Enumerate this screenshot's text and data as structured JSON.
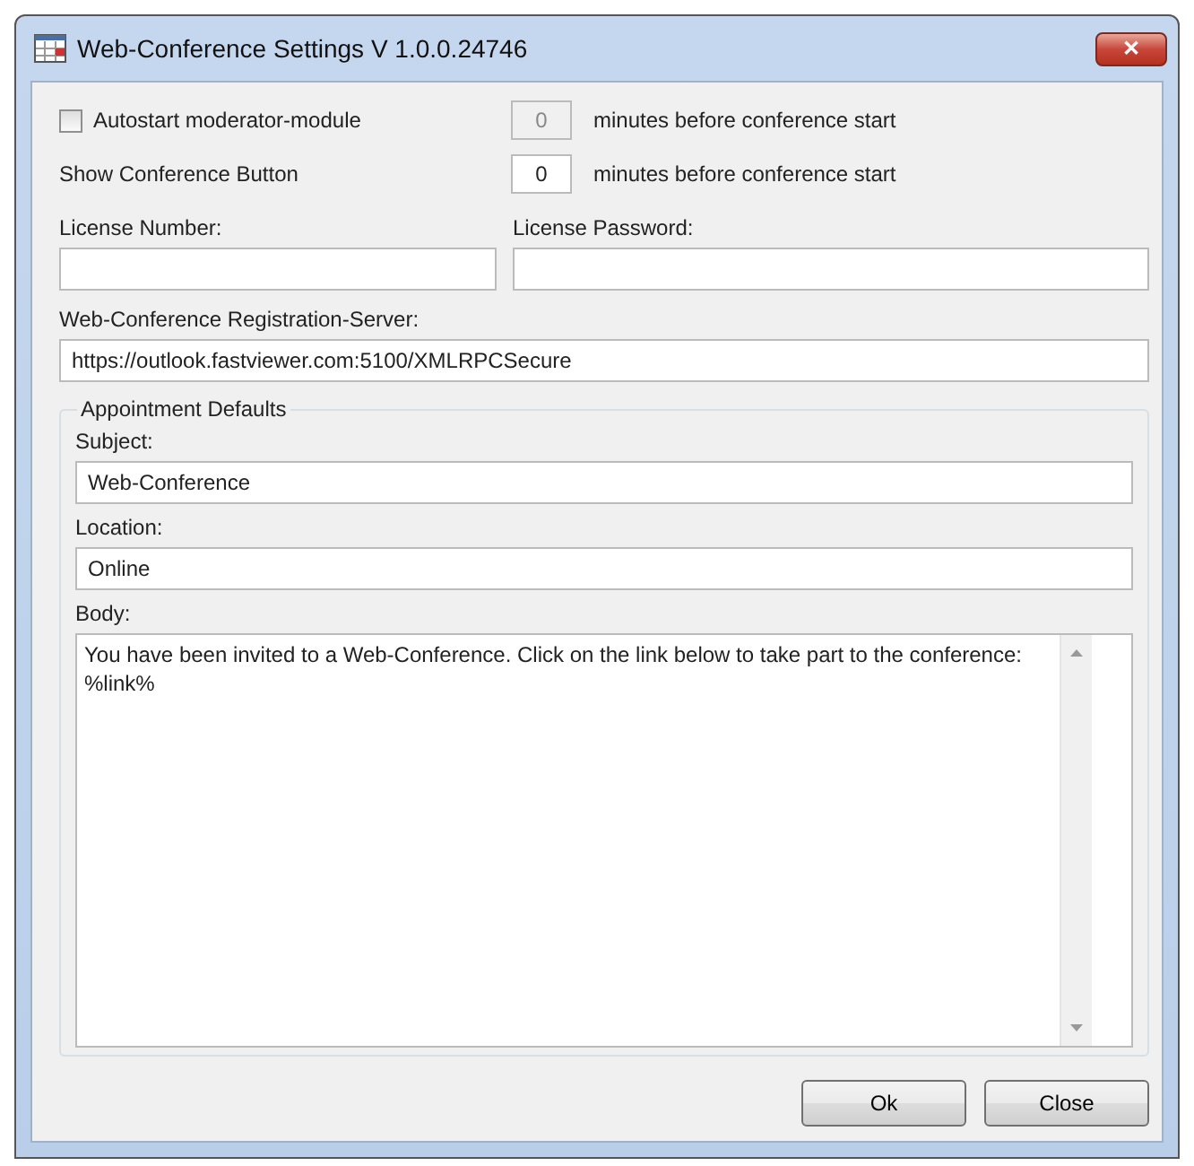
{
  "window": {
    "title": "Web-Conference Settings V 1.0.0.24746",
    "close": "✕"
  },
  "autostart": {
    "label": "Autostart moderator-module",
    "checked": false,
    "minutes": "0",
    "disabled": true,
    "suffix": "minutes before conference start"
  },
  "show_button": {
    "label": "Show Conference Button",
    "minutes": "0",
    "disabled": false,
    "suffix": "minutes before conference start"
  },
  "license_number": {
    "label": "License Number:"
  },
  "license_password": {
    "label": "License Password:"
  },
  "server": {
    "label": "Web-Conference Registration-Server:",
    "value": "https://outlook.fastviewer.com:5100/XMLRPCSecure"
  },
  "appointment_defaults": {
    "title": "Appointment Defaults",
    "subject": {
      "label": "Subject:",
      "value": "Web-Conference"
    },
    "location": {
      "label": "Location:",
      "value": "Online"
    },
    "body": {
      "label": "Body:",
      "value": "You have been invited to a Web-Conference. Click on the link below to take part to the conference:\n%link%"
    }
  },
  "buttons": [
    "Ok",
    "Close"
  ]
}
